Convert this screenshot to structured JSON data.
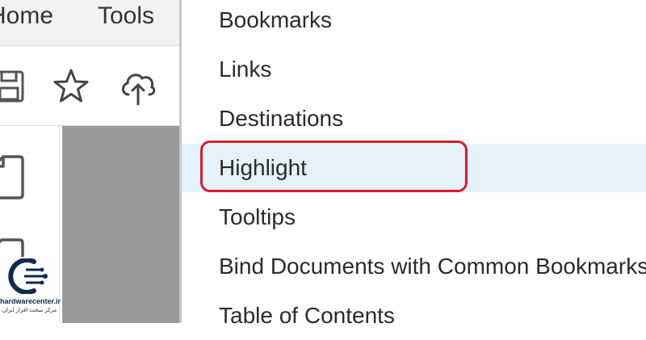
{
  "tabs": [
    {
      "label": "Home"
    },
    {
      "label": "Tools"
    }
  ],
  "toolbar": {
    "icons": [
      "save-icon",
      "star-icon",
      "cloud-upload-icon"
    ]
  },
  "side_panel": {
    "icons": [
      "page-icon",
      "page-icon"
    ]
  },
  "menu": {
    "items": [
      {
        "label": "Bookmarks",
        "active": false
      },
      {
        "label": "Links",
        "active": false
      },
      {
        "label": "Destinations",
        "active": false
      },
      {
        "label": "Highlight",
        "active": true
      },
      {
        "label": "Tooltips",
        "active": false
      },
      {
        "label": "Bind Documents with Common Bookmarks...",
        "active": false
      },
      {
        "label": "Table of Contents",
        "active": false
      }
    ]
  },
  "annotation": {
    "color": "#e0192a",
    "target": "Highlight"
  },
  "colors": {
    "active_bg": "#e5f1fb",
    "document_bg": "#9a9a9a",
    "logo_color": "#0d2a52"
  },
  "logo": {
    "title": "hardwarecenter.ir",
    "subtitle": "مرکز سخت افزار ایران"
  }
}
